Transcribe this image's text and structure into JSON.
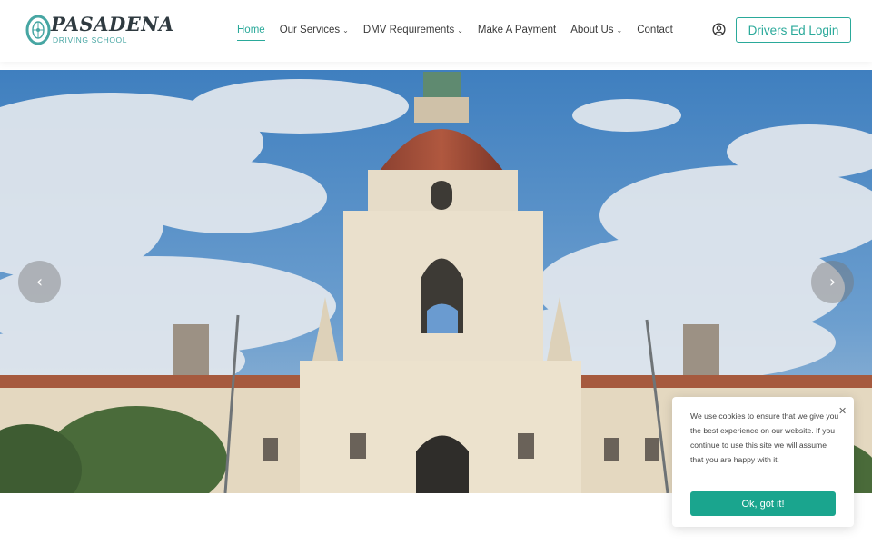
{
  "brand": {
    "name": "PASADENA",
    "tagline": "DRIVING SCHOOL",
    "accent_color": "#2aa99a"
  },
  "nav": {
    "items": [
      {
        "label": "Home",
        "active": true,
        "has_dropdown": false
      },
      {
        "label": "Our Services",
        "active": false,
        "has_dropdown": true
      },
      {
        "label": "DMV Requirements",
        "active": false,
        "has_dropdown": true
      },
      {
        "label": "Make A Payment",
        "active": false,
        "has_dropdown": false
      },
      {
        "label": "About Us",
        "active": false,
        "has_dropdown": true
      },
      {
        "label": "Contact",
        "active": false,
        "has_dropdown": false
      }
    ],
    "account_icon": "user-circle-icon",
    "login_label": "Drivers Ed Login"
  },
  "hero": {
    "prev_icon": "chevron-left-icon",
    "next_icon": "chevron-right-icon"
  },
  "cookie": {
    "text": "We use cookies to ensure that we give you the best experience on our website. If you continue to use this site we will assume that you are happy with it.",
    "button_label": "Ok, got it!",
    "close_icon": "close-icon",
    "button_color": "#1aa58e"
  }
}
